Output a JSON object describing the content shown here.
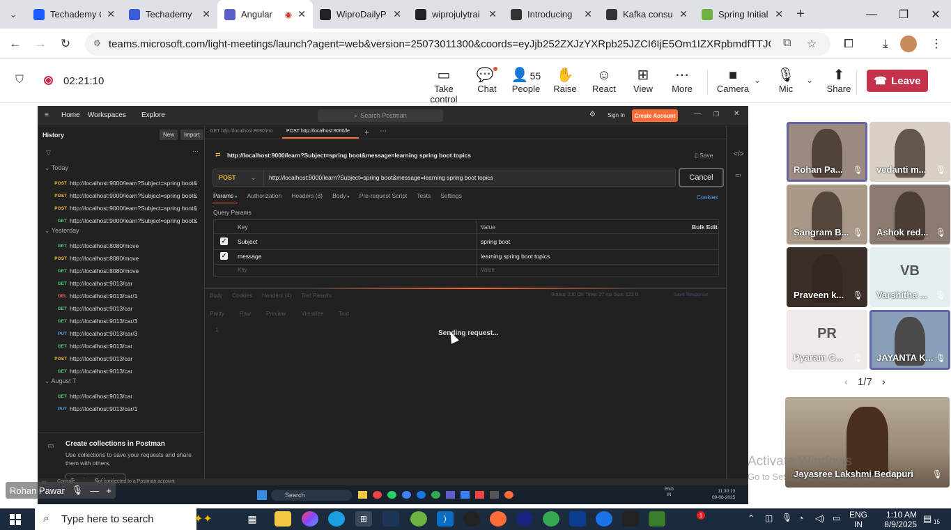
{
  "browser": {
    "tabs": [
      {
        "title": "Techademy C",
        "favicon": "techademy-icon",
        "color": "#1a5cff"
      },
      {
        "title": "Techademy",
        "favicon": "techademy-icon",
        "color": "#3b5bdb"
      },
      {
        "title": "Angular",
        "favicon": "teams-icon",
        "color": "#5b5fc7",
        "active": true
      },
      {
        "title": "WiproDailyP",
        "favicon": "github-icon",
        "color": "#222"
      },
      {
        "title": "wiprojulytrai",
        "favicon": "github-icon",
        "color": "#222"
      },
      {
        "title": "Introducing",
        "favicon": "openai-icon",
        "color": "#333"
      },
      {
        "title": "Kafka consu",
        "favicon": "openai-icon",
        "color": "#333"
      },
      {
        "title": "Spring Initial",
        "favicon": "spring-icon",
        "color": "#6db33f"
      }
    ],
    "url": "teams.microsoft.com/light-meetings/launch?agent=web&version=25073011300&coords=eyJjb252ZXJzYXRpb25JZCI6IjE5Om1IZXRpbmdfTTJGbFpEQXIN..."
  },
  "teams": {
    "timer": "02:21:10",
    "controls": [
      {
        "label": "Take control",
        "icon": "take-control-icon",
        "glyph": "▭"
      },
      {
        "label": "Chat",
        "icon": "chat-icon",
        "glyph": "💬"
      },
      {
        "label": "People",
        "icon": "people-icon",
        "glyph": "👤",
        "count": "55"
      },
      {
        "label": "Raise",
        "icon": "raise-hand-icon",
        "glyph": "✋"
      },
      {
        "label": "React",
        "icon": "react-icon",
        "glyph": "☺"
      },
      {
        "label": "View",
        "icon": "view-icon",
        "glyph": "⊞"
      },
      {
        "label": "More",
        "icon": "more-icon",
        "glyph": "⋯"
      },
      {
        "label": "Camera",
        "icon": "camera-icon",
        "glyph": "■"
      },
      {
        "label": "Mic",
        "icon": "mic-icon",
        "glyph": "🎙"
      },
      {
        "label": "Share",
        "icon": "share-icon",
        "glyph": "⬆"
      }
    ],
    "leave_label": "Leave",
    "pager": "1/7",
    "presenter": "Rohan Pawar",
    "participants": [
      {
        "name": "Rohan Pa...",
        "bg": "#9b8a80"
      },
      {
        "name": "vedanti m...",
        "bg": "#d8d0c4"
      },
      {
        "name": "Sangram B...",
        "bg": "#a89888"
      },
      {
        "name": "Ashok red...",
        "bg": "#8a7a70"
      },
      {
        "name": "Praveen k...",
        "bg": "#3a2e28"
      },
      {
        "name": "Varshitha ...",
        "initials": "VB",
        "bg": "#e3eef0"
      },
      {
        "name": "Pyaram C...",
        "initials": "PR",
        "bg": "#efeae8"
      },
      {
        "name": "JAYANTA K...",
        "bg": "#8aa0b8"
      }
    ],
    "spotlight": "Jayasree Lakshmi Bedapuri",
    "watermark": "Activate Windows",
    "watermark_sub": "Go to Settings to activate Windows."
  },
  "postman": {
    "nav": [
      "Home",
      "Workspaces",
      "Explore"
    ],
    "search_placeholder": "Search Postman",
    "sign_in": "Sign In",
    "create_account": "Create Account",
    "sidebar_title": "History",
    "new_label": "New",
    "import_label": "Import",
    "groups": [
      {
        "label": "Today",
        "items": [
          {
            "m": "POST",
            "u": "http://localhost:9000/learn?Subject=spring boot&"
          },
          {
            "m": "POST",
            "u": "http://localhost:9000/learn?Subject=spring boot&"
          },
          {
            "m": "POST",
            "u": "http://localhost:9000/learn?Subject=spring boot&"
          },
          {
            "m": "GET",
            "u": "http://localhost:9000/learn?Subject=spring boot&"
          }
        ]
      },
      {
        "label": "Yesterday",
        "items": [
          {
            "m": "GET",
            "u": "http://localhost:8080/move"
          },
          {
            "m": "POST",
            "u": "http://localhost:8080/move"
          },
          {
            "m": "GET",
            "u": "http://localhost:8080/move"
          },
          {
            "m": "GET",
            "u": "http://localhost:9013/car"
          },
          {
            "m": "DEL",
            "u": "http://localhost:9013/car/1"
          },
          {
            "m": "GET",
            "u": "http://localhost:9013/car"
          },
          {
            "m": "GET",
            "u": "http://localhost:9013/car/3"
          },
          {
            "m": "PUT",
            "u": "http://localhost:9013/car/3"
          },
          {
            "m": "GET",
            "u": "http://localhost:9013/car"
          },
          {
            "m": "POST",
            "u": "http://localhost:9013/car"
          },
          {
            "m": "GET",
            "u": "http://localhost:9013/car"
          }
        ]
      },
      {
        "label": "August 7",
        "items": [
          {
            "m": "GET",
            "u": "http://localhost:9013/car"
          },
          {
            "m": "PUT",
            "u": "http://localhost:9013/car/1"
          }
        ]
      }
    ],
    "collections_title": "Create collections in Postman",
    "collections_text": "Use collections to save your requests and share them with others.",
    "create_collection": "Create a Collection",
    "tabs": [
      "GET http://localhost:8080/mo",
      "POST http://localhost:9000/le"
    ],
    "request_title": "http://localhost:9000/learn?Subject=spring boot&message=learning spring boot topics",
    "save_label": "Save",
    "method": "POST",
    "url": "http://localhost:9000/learn?Subject=spring boot&message=learning spring boot topics",
    "cancel_label": "Cancel",
    "req_tabs": [
      "Params",
      "Authorization",
      "Headers (8)",
      "Body",
      "Pre-request Script",
      "Tests",
      "Settings"
    ],
    "cookies": "Cookies",
    "query_params": "Query Params",
    "col_key": "Key",
    "col_value": "Value",
    "bulk_edit": "Bulk Edit",
    "params": [
      {
        "key": "Subject",
        "value": "spring boot"
      },
      {
        "key": "message",
        "value": "learning spring boot topics"
      }
    ],
    "key_placeholder": "Key",
    "value_placeholder": "Value",
    "resp_tabs": [
      "Body",
      "Cookies",
      "Headers (4)",
      "Test Results"
    ],
    "resp_meta": "Status: 200 OK   Time: 27 ms   Size: 123 B",
    "save_response": "Save Response",
    "view_tabs": [
      "Pretty",
      "Raw",
      "Preview",
      "Visualize",
      "Text"
    ],
    "sending": "Sending request...",
    "status_console": "Console",
    "status_text": "Not connected to a Postman account"
  },
  "inner_taskbar": {
    "search": "Search",
    "lang": "ENG\nIN",
    "time": "11:30:13",
    "date": "09-08-2025"
  },
  "taskbar": {
    "search_placeholder": "Type here to search",
    "lang_line1": "ENG",
    "lang_line2": "IN",
    "time": "1:10 AM",
    "date": "8/9/2025",
    "notif_count": "15",
    "badge": "1"
  }
}
